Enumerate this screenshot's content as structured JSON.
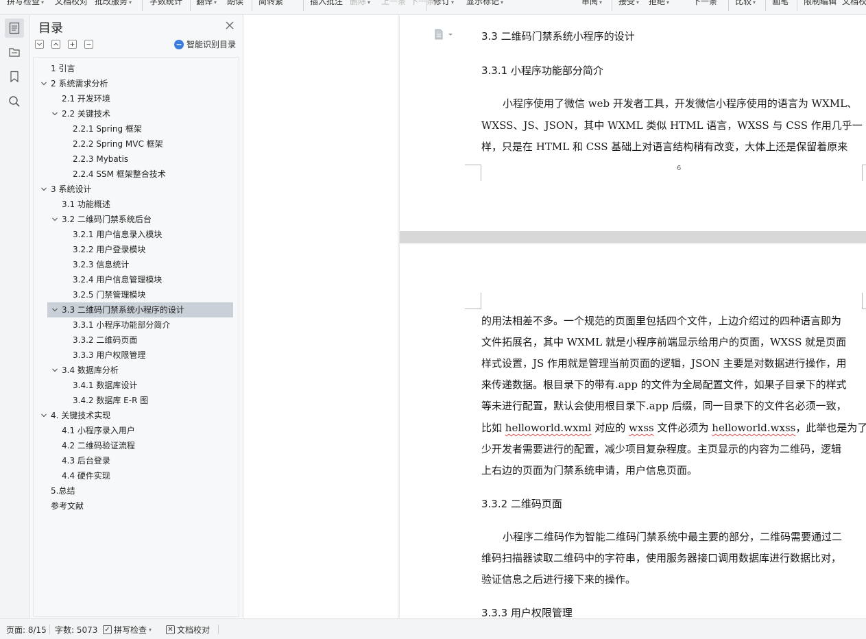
{
  "toolbar": {
    "items": [
      {
        "label": "拼写检查",
        "caret": "▾"
      },
      {
        "label": "文档校对",
        "caret": ""
      },
      {
        "label": "批改服务",
        "caret": "▾"
      },
      {
        "label": "字数统计",
        "caret": ""
      },
      {
        "label": "翻译",
        "caret": "▾"
      },
      {
        "label": "朗读",
        "caret": ""
      },
      {
        "label": "简转繁",
        "caret": ""
      },
      {
        "label": "插入批注",
        "caret": ""
      },
      {
        "label": "删除",
        "caret": "▾"
      },
      {
        "label": "上一条",
        "caret": ""
      },
      {
        "label": "下一条",
        "caret": ""
      },
      {
        "label": "修订",
        "caret": "▾"
      },
      {
        "label": "显示标记",
        "caret": "▾"
      },
      {
        "label": "审阅",
        "caret": "▾"
      },
      {
        "label": "接受",
        "caret": "▾"
      },
      {
        "label": "拒绝",
        "caret": "▾"
      },
      {
        "label": "下一条",
        "caret": ""
      },
      {
        "label": "比较",
        "caret": "▾"
      },
      {
        "label": "画笔",
        "caret": ""
      },
      {
        "label": "限制编辑",
        "caret": ""
      },
      {
        "label": "文档权",
        "caret": ""
      }
    ]
  },
  "toc": {
    "title": "目录",
    "smart_label": "智能识别目录",
    "items": [
      {
        "label": "1 引言",
        "level": 1,
        "arrow": false
      },
      {
        "label": "2 系统需求分析",
        "level": 1,
        "arrow": true
      },
      {
        "label": "2.1 开发环境",
        "level": 2,
        "arrow": false
      },
      {
        "label": "2.2 关键技术",
        "level": 2,
        "arrow": true
      },
      {
        "label": "2.2.1 Spring 框架",
        "level": 3,
        "arrow": false
      },
      {
        "label": "2.2.2 Spring MVC 框架",
        "level": 3,
        "arrow": false
      },
      {
        "label": "2.2.3 Mybatis",
        "level": 3,
        "arrow": false
      },
      {
        "label": "2.2.4 SSM 框架整合技术",
        "level": 3,
        "arrow": false
      },
      {
        "label": "3 系统设计",
        "level": 1,
        "arrow": true
      },
      {
        "label": "3.1 功能概述",
        "level": 2,
        "arrow": false
      },
      {
        "label": "3.2 二维码门禁系统后台",
        "level": 2,
        "arrow": true
      },
      {
        "label": "3.2.1 用户信息录入模块",
        "level": 3,
        "arrow": false
      },
      {
        "label": "3.2.2 用户登录模块",
        "level": 3,
        "arrow": false
      },
      {
        "label": "3.2.3 信息统计",
        "level": 3,
        "arrow": false
      },
      {
        "label": "3.2.4 用户信息管理模块",
        "level": 3,
        "arrow": false
      },
      {
        "label": "3.2.5 门禁管理模块",
        "level": 3,
        "arrow": false
      },
      {
        "label": "3.3 二维码门禁系统小程序的设计",
        "level": 2,
        "arrow": true,
        "selected": true
      },
      {
        "label": "3.3.1 小程序功能部分简介",
        "level": 3,
        "arrow": false
      },
      {
        "label": "3.3.2 二维码页面",
        "level": 3,
        "arrow": false
      },
      {
        "label": "3.3.3 用户权限管理",
        "level": 3,
        "arrow": false
      },
      {
        "label": "3.4 数据库分析",
        "level": 2,
        "arrow": true
      },
      {
        "label": "3.4.1 数据库设计",
        "level": 3,
        "arrow": false
      },
      {
        "label": "3.4.2 数据库 E-R 图",
        "level": 3,
        "arrow": false
      },
      {
        "label": "4. 关键技术实现",
        "level": 1,
        "arrow": true
      },
      {
        "label": "4.1 小程序录入用户",
        "level": 2,
        "arrow": false
      },
      {
        "label": "4.2 二维码验证流程",
        "level": 2,
        "arrow": false
      },
      {
        "label": "4.3 后台登录",
        "level": 2,
        "arrow": false
      },
      {
        "label": "4.4 硬件实现",
        "level": 2,
        "arrow": false
      },
      {
        "label": "5.总结",
        "level": 1,
        "arrow": false
      },
      {
        "label": "参考文献",
        "level": 1,
        "arrow": false
      }
    ]
  },
  "document": {
    "page6": {
      "heading_33": "3.3 二维码门禁系统小程序的设计",
      "heading_331": "3.3.1 小程序功能部分简介",
      "para_lines": [
        "小程序使用了微信 web 开发者工具，开发微信小程序使用的语言为 WXML、",
        "WXSS、JS、JSON，其中 WXML 类似 HTML 语言，WXSS 与 CSS 作用几乎一",
        "样，只是在 HTML 和 CSS 基础上对语言结构稍有改变，大体上还是保留着原来"
      ],
      "page_number": "6"
    },
    "page7": {
      "para1_lines": [
        "的用法相差不多。一个规范的页面里包括四个文件，上边介绍过的四种语言即为",
        "文件拓展名，其中 WXML 就是小程序前端显示给用户的页面，WXSS 就是页面",
        "样式设置，JS 作用就是管理当前页面的逻辑，JSON 主要是对数据进行操作，用",
        "来传递数据。根目录下的带有.app 的文件为全局配置文件，如果子目录下的样式",
        "等未进行配置，默认会使用根目录下.app 后缀，同一目录下的文件名必须一致，"
      ],
      "line6_a": "比如 ",
      "line6_b": "helloworld.wxml",
      "line6_c": " 对应的 ",
      "line6_d": "wxss",
      "line6_e": " 文件必须为 ",
      "line6_f": "helloworld.wxss",
      "line6_g": "，此举也是为了减",
      "para1_tail": [
        "少开发者需要进行的配置，减少项目复杂程度。主页显示的内容为二维码，逻辑",
        "上右边的页面为门禁系统申请，用户信息页面。"
      ],
      "heading_332": "3.3.2 二维码页面",
      "para2_lines": [
        "小程序二维码作为智能二维码门禁系统中最主要的部分，二维码需要通过二",
        "维码扫描器读取二维码中的字符串，使用服务器接口调用数据库进行数据比对，",
        "验证信息之后进行接下来的操作。"
      ],
      "heading_333": "3.3.3 用户权限管理"
    }
  },
  "statusbar": {
    "page": "页面: 8/15",
    "words": "字数: 5073",
    "spell": "拼写检查",
    "proof": "文档校对"
  },
  "colors": {
    "selection": "#c9d0d8",
    "accent_blue": "#3b7ddd",
    "squiggle": "#e04848"
  }
}
